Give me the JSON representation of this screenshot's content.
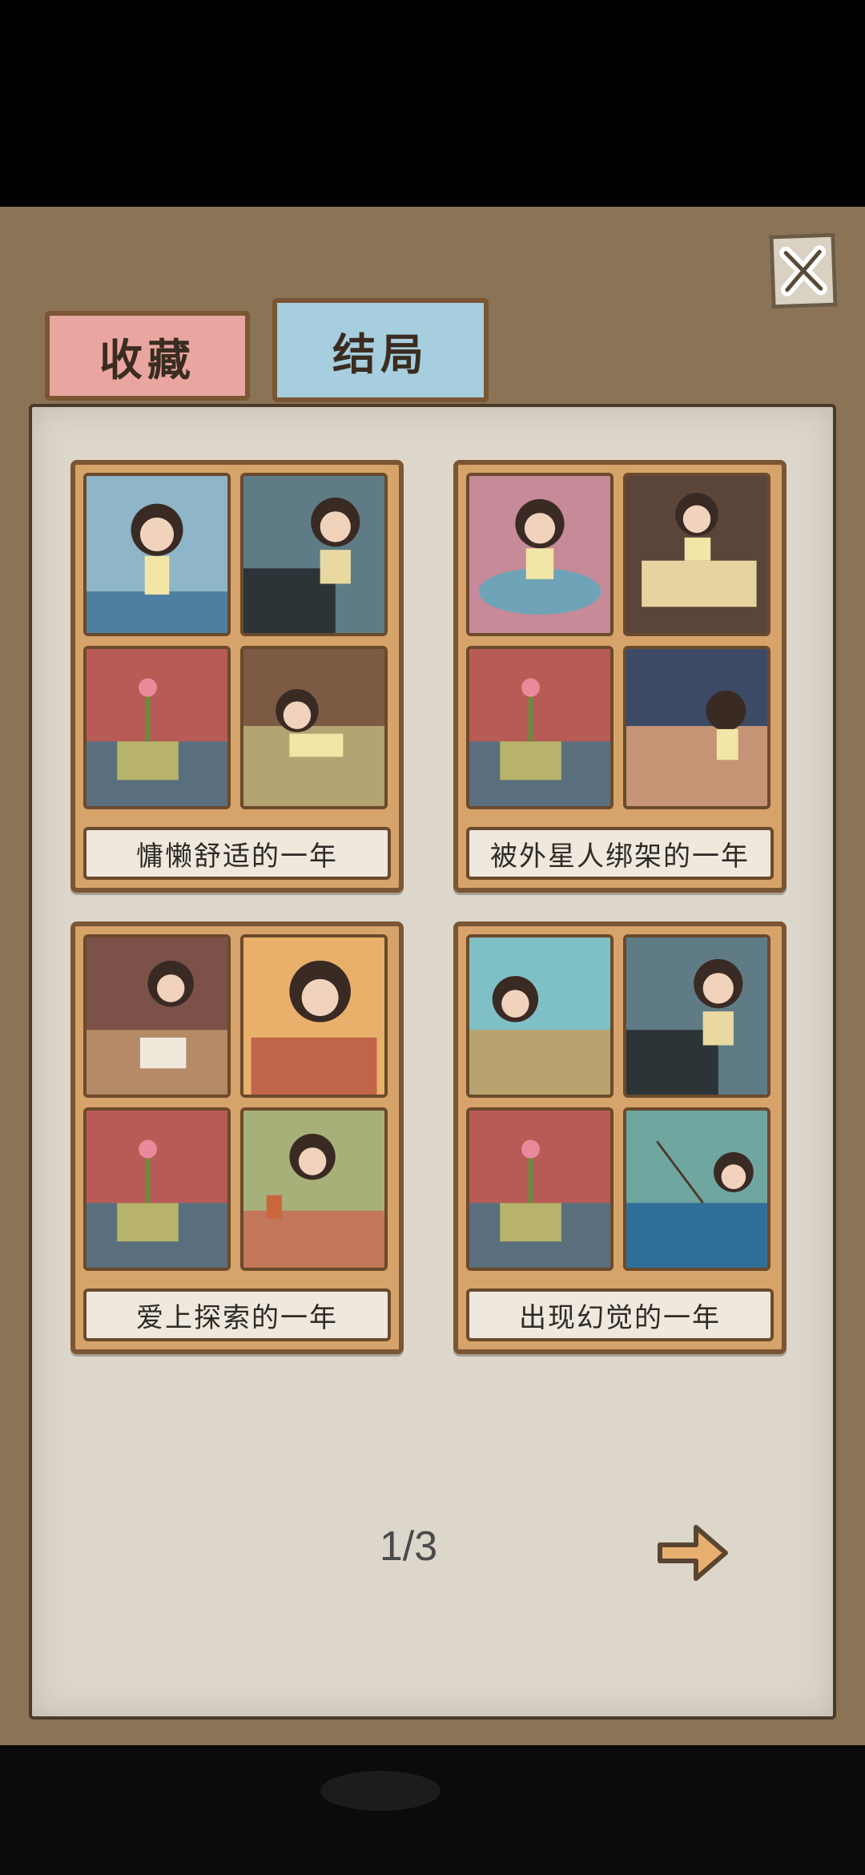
{
  "tabs": {
    "collect_label": "收藏",
    "ending_label": "结局",
    "active": "结局"
  },
  "close_icon": "close-icon",
  "endings": [
    {
      "title": "慵懒舒适的一年"
    },
    {
      "title": "被外星人绑架的一年"
    },
    {
      "title": "爱上探索的一年"
    },
    {
      "title": "出现幻觉的一年"
    }
  ],
  "pagination": {
    "label": "1/3",
    "next_icon": "arrow-right-icon"
  },
  "colors": {
    "board": "#8b7356",
    "panel": "#dcd6cb",
    "card": "#d6a36a",
    "tab_collect": "#e9a6a0",
    "tab_ending": "#a6cedf"
  }
}
